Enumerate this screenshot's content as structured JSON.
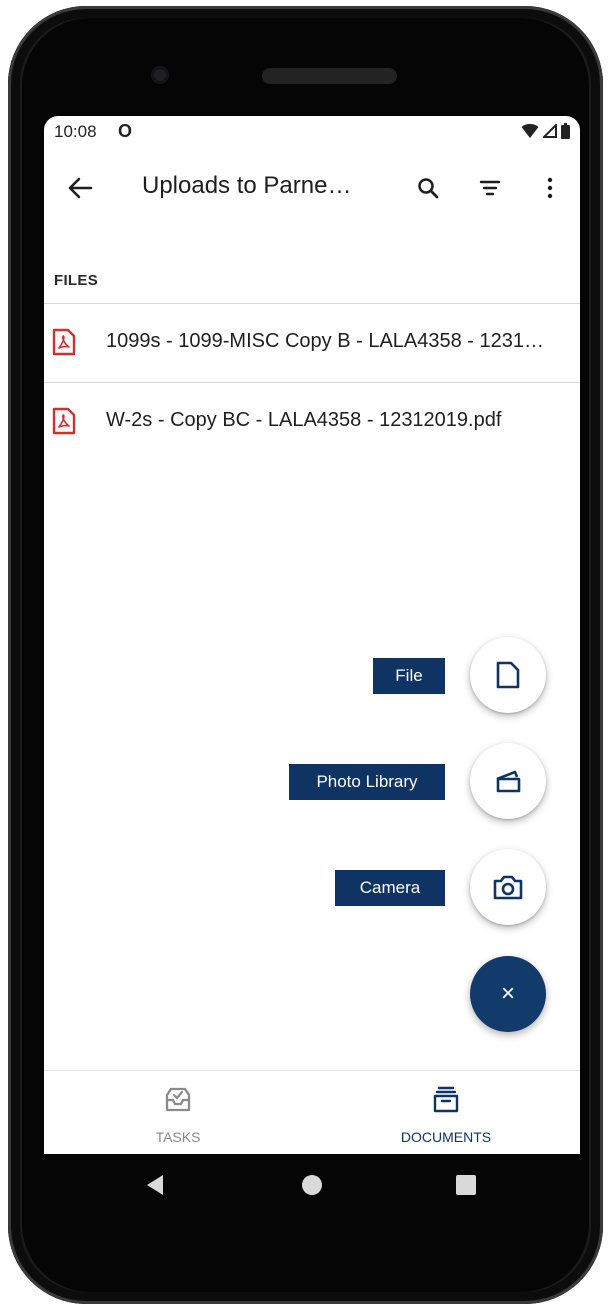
{
  "status_bar": {
    "time": "10:08",
    "notification_icon": "O"
  },
  "app_bar": {
    "title": "Uploads to Parne…",
    "icons": [
      "back-arrow-icon",
      "search-icon",
      "filter-icon",
      "more-vert-icon"
    ]
  },
  "files": {
    "header": "FILES",
    "items": [
      {
        "name": "1099s - 1099-MISC Copy B - LALA4358 - 1231…",
        "icon": "pdf-icon"
      },
      {
        "name": "W-2s - Copy BC - LALA4358 - 12312019.pdf",
        "icon": "pdf-icon"
      }
    ]
  },
  "fab_menu": {
    "file_label": "File",
    "photo_library_label": "Photo Library",
    "camera_label": "Camera",
    "close_symbol": "×"
  },
  "bottom_nav": {
    "tasks_label": "TASKS",
    "documents_label": "DOCUMENTS"
  },
  "colors": {
    "accent_navy": "#0f3463",
    "pdf_red": "#d0312d",
    "inactive_gray": "#8a8a8a"
  }
}
